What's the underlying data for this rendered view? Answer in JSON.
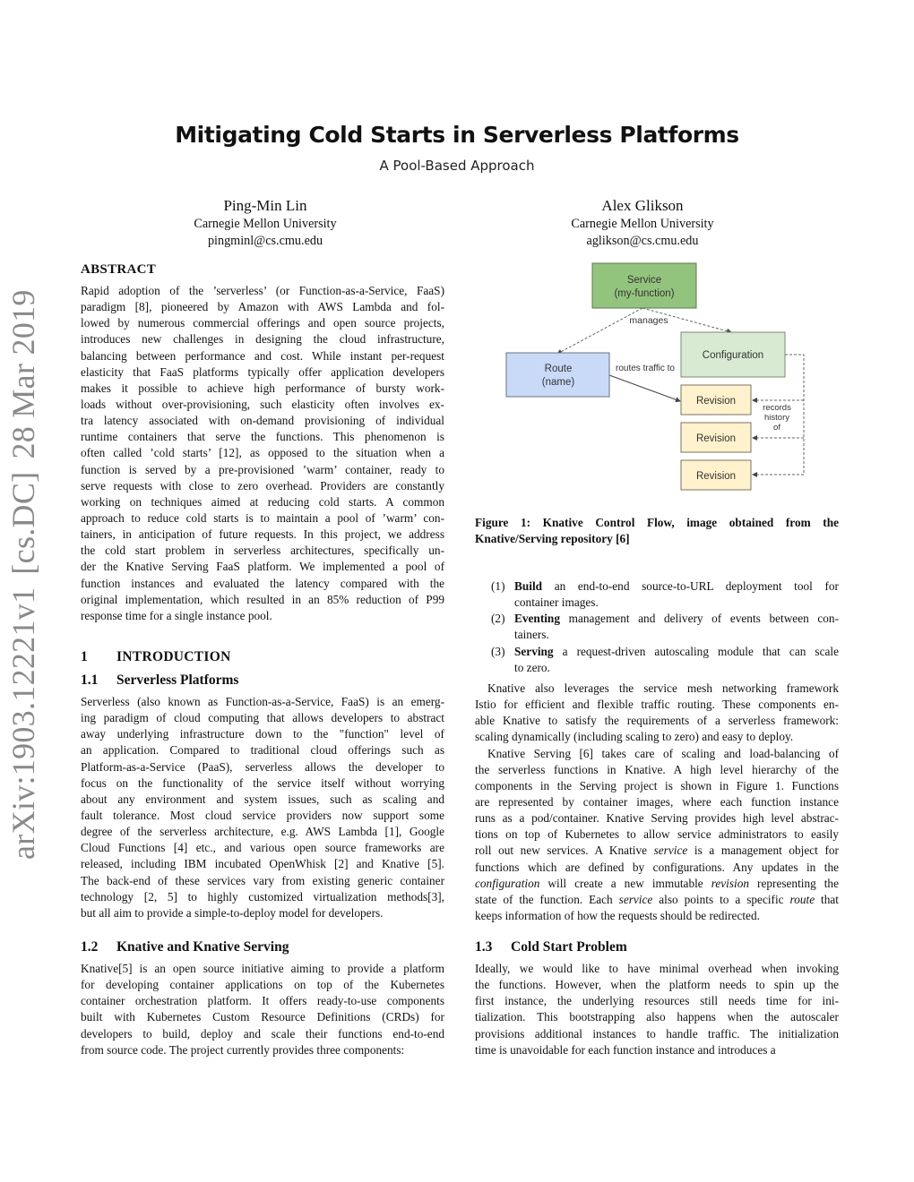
{
  "paper": {
    "title": "Mitigating Cold Starts in Serverless Platforms",
    "subtitle": "A Pool-Based Approach",
    "authors": [
      {
        "name": "Ping-Min Lin",
        "affiliation": "Carnegie Mellon University",
        "email": "pingminl@cs.cmu.edu"
      },
      {
        "name": "Alex Glikson",
        "affiliation": "Carnegie Mellon University",
        "email": "aglikson@cs.cmu.edu"
      }
    ],
    "arxiv_stamp": {
      "id": "arXiv:1903.12221v1",
      "category": "[cs.DC]",
      "date": "28 Mar 2019"
    }
  },
  "abstract": {
    "heading": "ABSTRACT",
    "lines": [
      "Rapid adoption of the ’serverless’ (or Function-as-a-Service, FaaS)",
      "paradigm [8], pioneered by Amazon with AWS Lambda and fol-",
      "lowed by numerous commercial offerings and open source projects,",
      "introduces new challenges in designing the cloud infrastructure,",
      "balancing between performance and cost. While instant per-request",
      "elasticity that FaaS platforms typically offer application developers",
      "makes it possible to achieve high performance of bursty work-",
      "loads without over-provisioning, such elasticity often involves ex-",
      "tra latency associated with on-demand provisioning of individual",
      "runtime containers that serve the functions. This phenomenon is",
      "often called ’cold starts’ [12], as opposed to the situation when a",
      "function is served by a pre-provisioned ’warm’ container, ready to",
      "serve requests with close to zero overhead. Providers are constantly",
      "working on techniques aimed at reducing cold starts. A common",
      "approach to reduce cold starts is to maintain a pool of ’warm’ con-",
      "tainers, in anticipation of future requests. In this project, we address",
      "the cold start problem in serverless architectures, specifically un-",
      "der the Knative Serving FaaS platform. We implemented a pool of",
      "function instances and evaluated the latency compared with the",
      "original implementation, which resulted in an 85% reduction of P99",
      "response time for a single instance pool."
    ]
  },
  "sections": {
    "intro": {
      "number": "1",
      "title": "INTRODUCTION"
    },
    "s1_1": {
      "number": "1.1",
      "title": "Serverless Platforms",
      "lines": [
        "Serverless (also known as Function-as-a-Service, FaaS) is an emerg-",
        "ing paradigm of cloud computing that allows developers to abstract",
        "away underlying infrastructure down to the \"function\" level of",
        "an application. Compared to traditional cloud offerings such as",
        "Platform-as-a-Service (PaaS), serverless allows the developer to",
        "focus on the functionality of the service itself without worrying",
        "about any environment and system issues, such as scaling and",
        "fault tolerance. Most cloud service providers now support some",
        "degree of the serverless architecture, e.g. AWS Lambda [1], Google",
        "Cloud Functions [4] etc., and various open source frameworks are",
        "released, including IBM incubated OpenWhisk [2] and Knative [5].",
        "The back-end of these services vary from existing generic container",
        "technology [2, 5] to highly customized virtualization methods[3],",
        "but all aim to provide a simple-to-deploy model for developers."
      ]
    },
    "s1_2": {
      "number": "1.2",
      "title": "Knative and Knative Serving",
      "lines": [
        "Knative[5] is an open source initiative aiming to provide a platform",
        "for developing container applications on top of the Kubernetes",
        "container orchestration platform. It offers ready-to-use components",
        "built with Kubernetes Custom Resource Definitions (CRDs) for",
        "developers to build, deploy and scale their functions end-to-end",
        "from source code. The project currently provides three components:"
      ]
    },
    "components_list": [
      {
        "num": "(1)",
        "term": "Build",
        "lines": [
          "an end-to-end source-to-URL deployment tool for",
          "container images."
        ]
      },
      {
        "num": "(2)",
        "term": "Eventing",
        "lines": [
          "management and delivery of events between con-",
          "tainers."
        ]
      },
      {
        "num": "(3)",
        "term": "Serving",
        "lines": [
          "a request-driven autoscaling module that can scale",
          "to zero."
        ]
      }
    ],
    "right_para1": [
      "Knative also leverages the service mesh networking framework",
      "Istio for efficient and flexible traffic routing. These components en-",
      "able Knative to satisfy the requirements of a serverless framework:",
      "scaling dynamically (including scaling to zero) and easy to deploy."
    ],
    "right_para2": [
      {
        "segs": [
          {
            "t": "Knative Serving [6] takes care of scaling and load-balancing of"
          }
        ]
      },
      {
        "segs": [
          {
            "t": "the serverless functions in Knative. A high level hierarchy of the"
          }
        ]
      },
      {
        "segs": [
          {
            "t": "components in the Serving project is shown in Figure 1. Functions"
          }
        ]
      },
      {
        "segs": [
          {
            "t": "are represented by container images, where each function instance"
          }
        ]
      },
      {
        "segs": [
          {
            "t": "runs as a pod/container. Knative Serving provides high level abstrac-"
          }
        ]
      },
      {
        "segs": [
          {
            "t": "tions on top of Kubernetes to allow service administrators to easily"
          }
        ]
      },
      {
        "segs": [
          {
            "t": "roll out new services. A Knative "
          },
          {
            "t": "service",
            "i": true
          },
          {
            "t": " is a management object for"
          }
        ]
      },
      {
        "segs": [
          {
            "t": "functions which are defined by configurations. Any updates in the"
          }
        ]
      },
      {
        "segs": [
          {
            "t": "configuration",
            "i": true
          },
          {
            "t": " will create a new immutable "
          },
          {
            "t": "revision",
            "i": true
          },
          {
            "t": " representing the"
          }
        ]
      },
      {
        "segs": [
          {
            "t": "state of the function. Each "
          },
          {
            "t": "service",
            "i": true
          },
          {
            "t": " also points to a specific "
          },
          {
            "t": "route",
            "i": true
          },
          {
            "t": " that"
          }
        ]
      },
      {
        "segs": [
          {
            "t": "keeps information of how the requests should be redirected."
          }
        ]
      }
    ],
    "s1_3": {
      "number": "1.3",
      "title": "Cold Start Problem",
      "lines": [
        "Ideally, we would like to have minimal overhead when invoking",
        "the functions. However, when the platform needs to spin up the",
        "first instance, the underlying resources still needs time for ini-",
        "tialization. This bootstrapping also happens when the autoscaler",
        "provisions additional instances to handle traffic. The initialization",
        "time is unavoidable for each function instance and introduces a"
      ]
    }
  },
  "figure1": {
    "caption_lines": [
      "Figure 1: Knative Control Flow, image obtained from the",
      "Knative/Serving repository [6]"
    ],
    "nodes": {
      "service": {
        "line1": "Service",
        "line2": "(my-function)",
        "fill": "#93c47d",
        "stroke": "#5b7a4a"
      },
      "configuration": {
        "line1": "Configuration",
        "fill": "#d9ead3",
        "stroke": "#7a8a74"
      },
      "route": {
        "line1": "Route",
        "line2": "(name)",
        "fill": "#c9daf8",
        "stroke": "#6b7280"
      },
      "revisions": [
        {
          "label": "Revision"
        },
        {
          "label": "Revision"
        },
        {
          "label": "Revision"
        }
      ],
      "revision_fill": "#fff2cc",
      "revision_stroke": "#7a7360"
    },
    "edge_labels": {
      "manages": "manages",
      "routes": "routes traffic to",
      "records1": "records",
      "records2": "history",
      "records3": "of"
    }
  }
}
